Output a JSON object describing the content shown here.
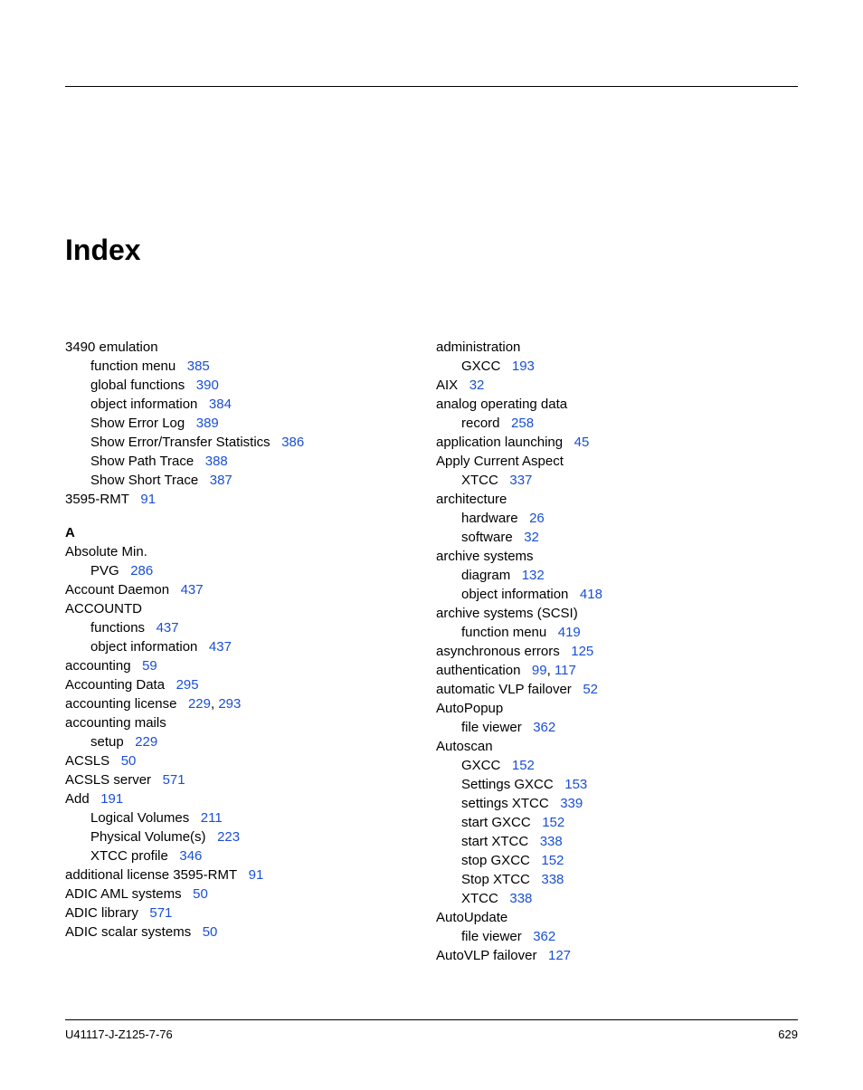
{
  "title": "Index",
  "footer": {
    "left": "U41117-J-Z125-7-76",
    "right": "629"
  },
  "col1": [
    {
      "t": "3490 emulation",
      "lvl": 0
    },
    {
      "t": "function menu",
      "p": [
        "385"
      ],
      "lvl": 1
    },
    {
      "t": "global functions",
      "p": [
        "390"
      ],
      "lvl": 1
    },
    {
      "t": "object information",
      "p": [
        "384"
      ],
      "lvl": 1
    },
    {
      "t": "Show Error Log",
      "p": [
        "389"
      ],
      "lvl": 1
    },
    {
      "t": "Show Error/Transfer Statistics",
      "p": [
        "386"
      ],
      "lvl": 1
    },
    {
      "t": "Show Path Trace",
      "p": [
        "388"
      ],
      "lvl": 1
    },
    {
      "t": "Show Short Trace",
      "p": [
        "387"
      ],
      "lvl": 1
    },
    {
      "t": "3595-RMT",
      "p": [
        "91"
      ],
      "lvl": 0
    },
    {
      "letter": "A"
    },
    {
      "t": "Absolute Min.",
      "lvl": 0
    },
    {
      "t": "PVG",
      "p": [
        "286"
      ],
      "lvl": 1
    },
    {
      "t": "Account Daemon",
      "p": [
        "437"
      ],
      "lvl": 0
    },
    {
      "t": "ACCOUNTD",
      "lvl": 0
    },
    {
      "t": "functions",
      "p": [
        "437"
      ],
      "lvl": 1
    },
    {
      "t": "object information",
      "p": [
        "437"
      ],
      "lvl": 1
    },
    {
      "t": "accounting",
      "p": [
        "59"
      ],
      "lvl": 0
    },
    {
      "t": "Accounting Data",
      "p": [
        "295"
      ],
      "lvl": 0
    },
    {
      "t": "accounting license",
      "p": [
        "229",
        "293"
      ],
      "lvl": 0
    },
    {
      "t": "accounting mails",
      "lvl": 0
    },
    {
      "t": "setup",
      "p": [
        "229"
      ],
      "lvl": 1
    },
    {
      "t": "ACSLS",
      "p": [
        "50"
      ],
      "lvl": 0
    },
    {
      "t": "ACSLS server",
      "p": [
        "571"
      ],
      "lvl": 0
    },
    {
      "t": "Add",
      "p": [
        "191"
      ],
      "lvl": 0
    },
    {
      "t": "Logical Volumes",
      "p": [
        "211"
      ],
      "lvl": 1
    },
    {
      "t": "Physical Volume(s)",
      "p": [
        "223"
      ],
      "lvl": 1
    },
    {
      "t": "XTCC profile",
      "p": [
        "346"
      ],
      "lvl": 1
    },
    {
      "t": "additional license 3595-RMT",
      "p": [
        "91"
      ],
      "lvl": 0
    },
    {
      "t": "ADIC AML systems",
      "p": [
        "50"
      ],
      "lvl": 0
    },
    {
      "t": "ADIC library",
      "p": [
        "571"
      ],
      "lvl": 0
    },
    {
      "t": "ADIC scalar systems",
      "p": [
        "50"
      ],
      "lvl": 0
    }
  ],
  "col2": [
    {
      "t": "administration",
      "lvl": 0
    },
    {
      "t": "GXCC",
      "p": [
        "193"
      ],
      "lvl": 1
    },
    {
      "t": "AIX",
      "p": [
        "32"
      ],
      "lvl": 0
    },
    {
      "t": "analog operating data",
      "lvl": 0
    },
    {
      "t": "record",
      "p": [
        "258"
      ],
      "lvl": 1
    },
    {
      "t": "application launching",
      "p": [
        "45"
      ],
      "lvl": 0
    },
    {
      "t": "Apply Current Aspect",
      "lvl": 0
    },
    {
      "t": "XTCC",
      "p": [
        "337"
      ],
      "lvl": 1
    },
    {
      "t": "architecture",
      "lvl": 0
    },
    {
      "t": "hardware",
      "p": [
        "26"
      ],
      "lvl": 1
    },
    {
      "t": "software",
      "p": [
        "32"
      ],
      "lvl": 1
    },
    {
      "t": "archive systems",
      "lvl": 0
    },
    {
      "t": "diagram",
      "p": [
        "132"
      ],
      "lvl": 1
    },
    {
      "t": "object information",
      "p": [
        "418"
      ],
      "lvl": 1
    },
    {
      "t": "archive systems (SCSI)",
      "lvl": 0
    },
    {
      "t": "function menu",
      "p": [
        "419"
      ],
      "lvl": 1
    },
    {
      "t": "asynchronous errors",
      "p": [
        "125"
      ],
      "lvl": 0
    },
    {
      "t": "authentication",
      "p": [
        "99",
        "117"
      ],
      "lvl": 0
    },
    {
      "t": "automatic VLP failover",
      "p": [
        "52"
      ],
      "lvl": 0
    },
    {
      "t": "AutoPopup",
      "lvl": 0
    },
    {
      "t": "file viewer",
      "p": [
        "362"
      ],
      "lvl": 1
    },
    {
      "t": "Autoscan",
      "lvl": 0
    },
    {
      "t": "GXCC",
      "p": [
        "152"
      ],
      "lvl": 1
    },
    {
      "t": "Settings GXCC",
      "p": [
        "153"
      ],
      "lvl": 1
    },
    {
      "t": "settings XTCC",
      "p": [
        "339"
      ],
      "lvl": 1
    },
    {
      "t": "start GXCC",
      "p": [
        "152"
      ],
      "lvl": 1
    },
    {
      "t": "start XTCC",
      "p": [
        "338"
      ],
      "lvl": 1
    },
    {
      "t": "stop GXCC",
      "p": [
        "152"
      ],
      "lvl": 1
    },
    {
      "t": "Stop XTCC",
      "p": [
        "338"
      ],
      "lvl": 1
    },
    {
      "t": "XTCC",
      "p": [
        "338"
      ],
      "lvl": 1
    },
    {
      "t": "AutoUpdate",
      "lvl": 0
    },
    {
      "t": "file viewer",
      "p": [
        "362"
      ],
      "lvl": 1
    },
    {
      "t": "AutoVLP failover",
      "p": [
        "127"
      ],
      "lvl": 0
    }
  ]
}
